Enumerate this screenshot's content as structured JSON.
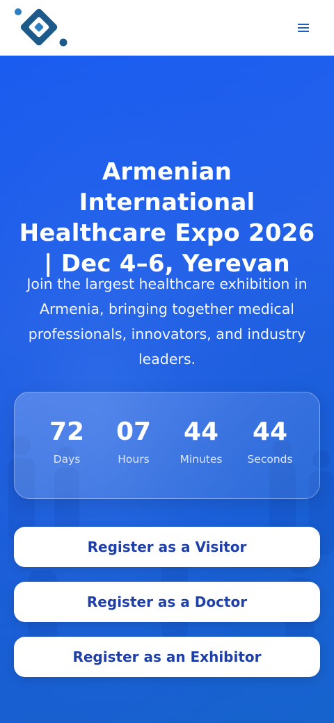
{
  "header": {
    "logo_icon": "brand-logo",
    "menu_icon": "hamburger-menu-icon",
    "colors": {
      "logo_dark": "#1d5a8a",
      "logo_light": "#2e7fbf",
      "menu": "#1f5fbf"
    }
  },
  "hero": {
    "title": "Armenian International Healthcare Expo 2026 | Dec 4–6, Yerevan",
    "subtitle": "Join the largest healthcare exhibition in Armenia, bringing together medical professionals, innovators, and industry leaders.",
    "background_color": "#1f5fea"
  },
  "countdown": {
    "days": {
      "value": "72",
      "label": "Days"
    },
    "hours": {
      "value": "07",
      "label": "Hours"
    },
    "minutes": {
      "value": "44",
      "label": "Minutes"
    },
    "seconds": {
      "value": "44",
      "label": "Seconds"
    }
  },
  "buttons": {
    "visitor": "Register as a Visitor",
    "doctor": "Register as a Doctor",
    "exhibitor": "Register as an Exhibitor",
    "text_color": "#1f3fa8"
  }
}
